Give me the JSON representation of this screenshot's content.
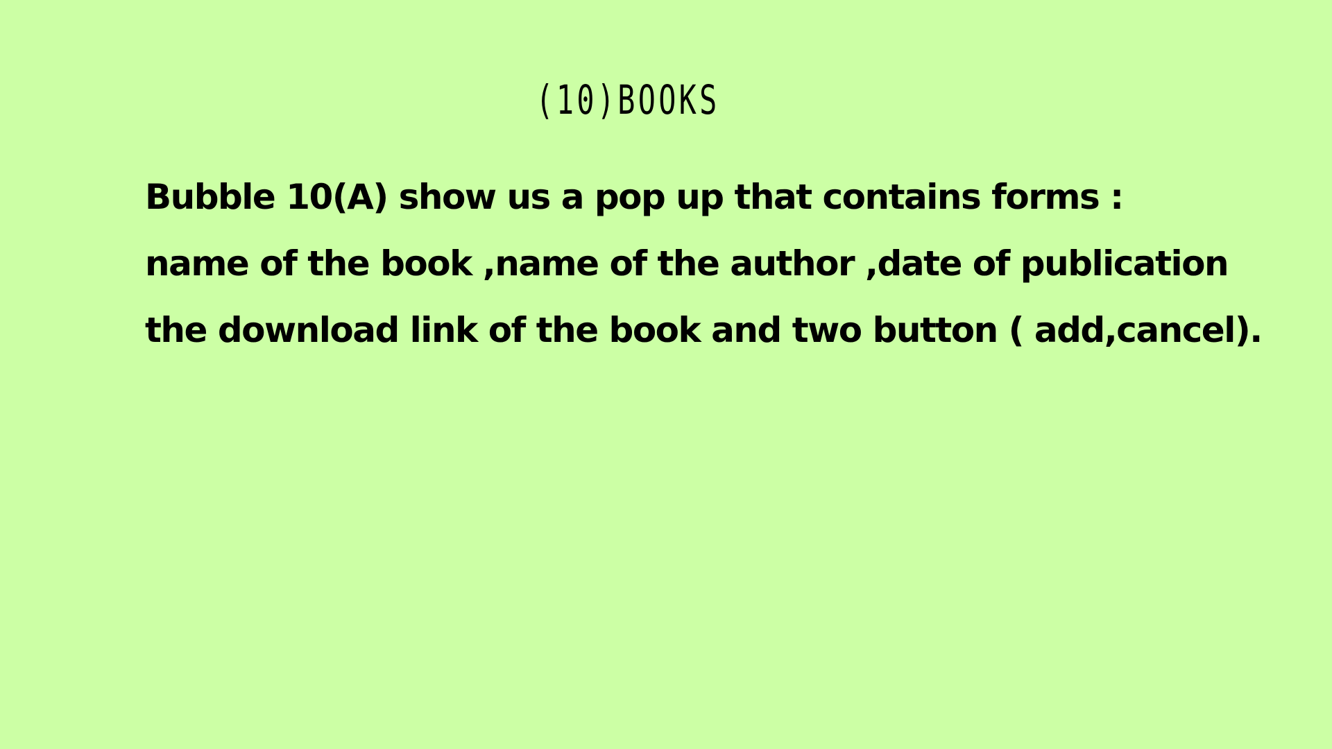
{
  "slide": {
    "title": "(10)BOOKS",
    "lines": [
      "Bubble 10(A) show us  a pop up that contains forms :",
      "name of  the book ,name of the author ,date of publication",
      "the download link of the book and two button ( add,cancel)."
    ]
  },
  "colors": {
    "background": "#ccffa5",
    "text": "#000000"
  }
}
